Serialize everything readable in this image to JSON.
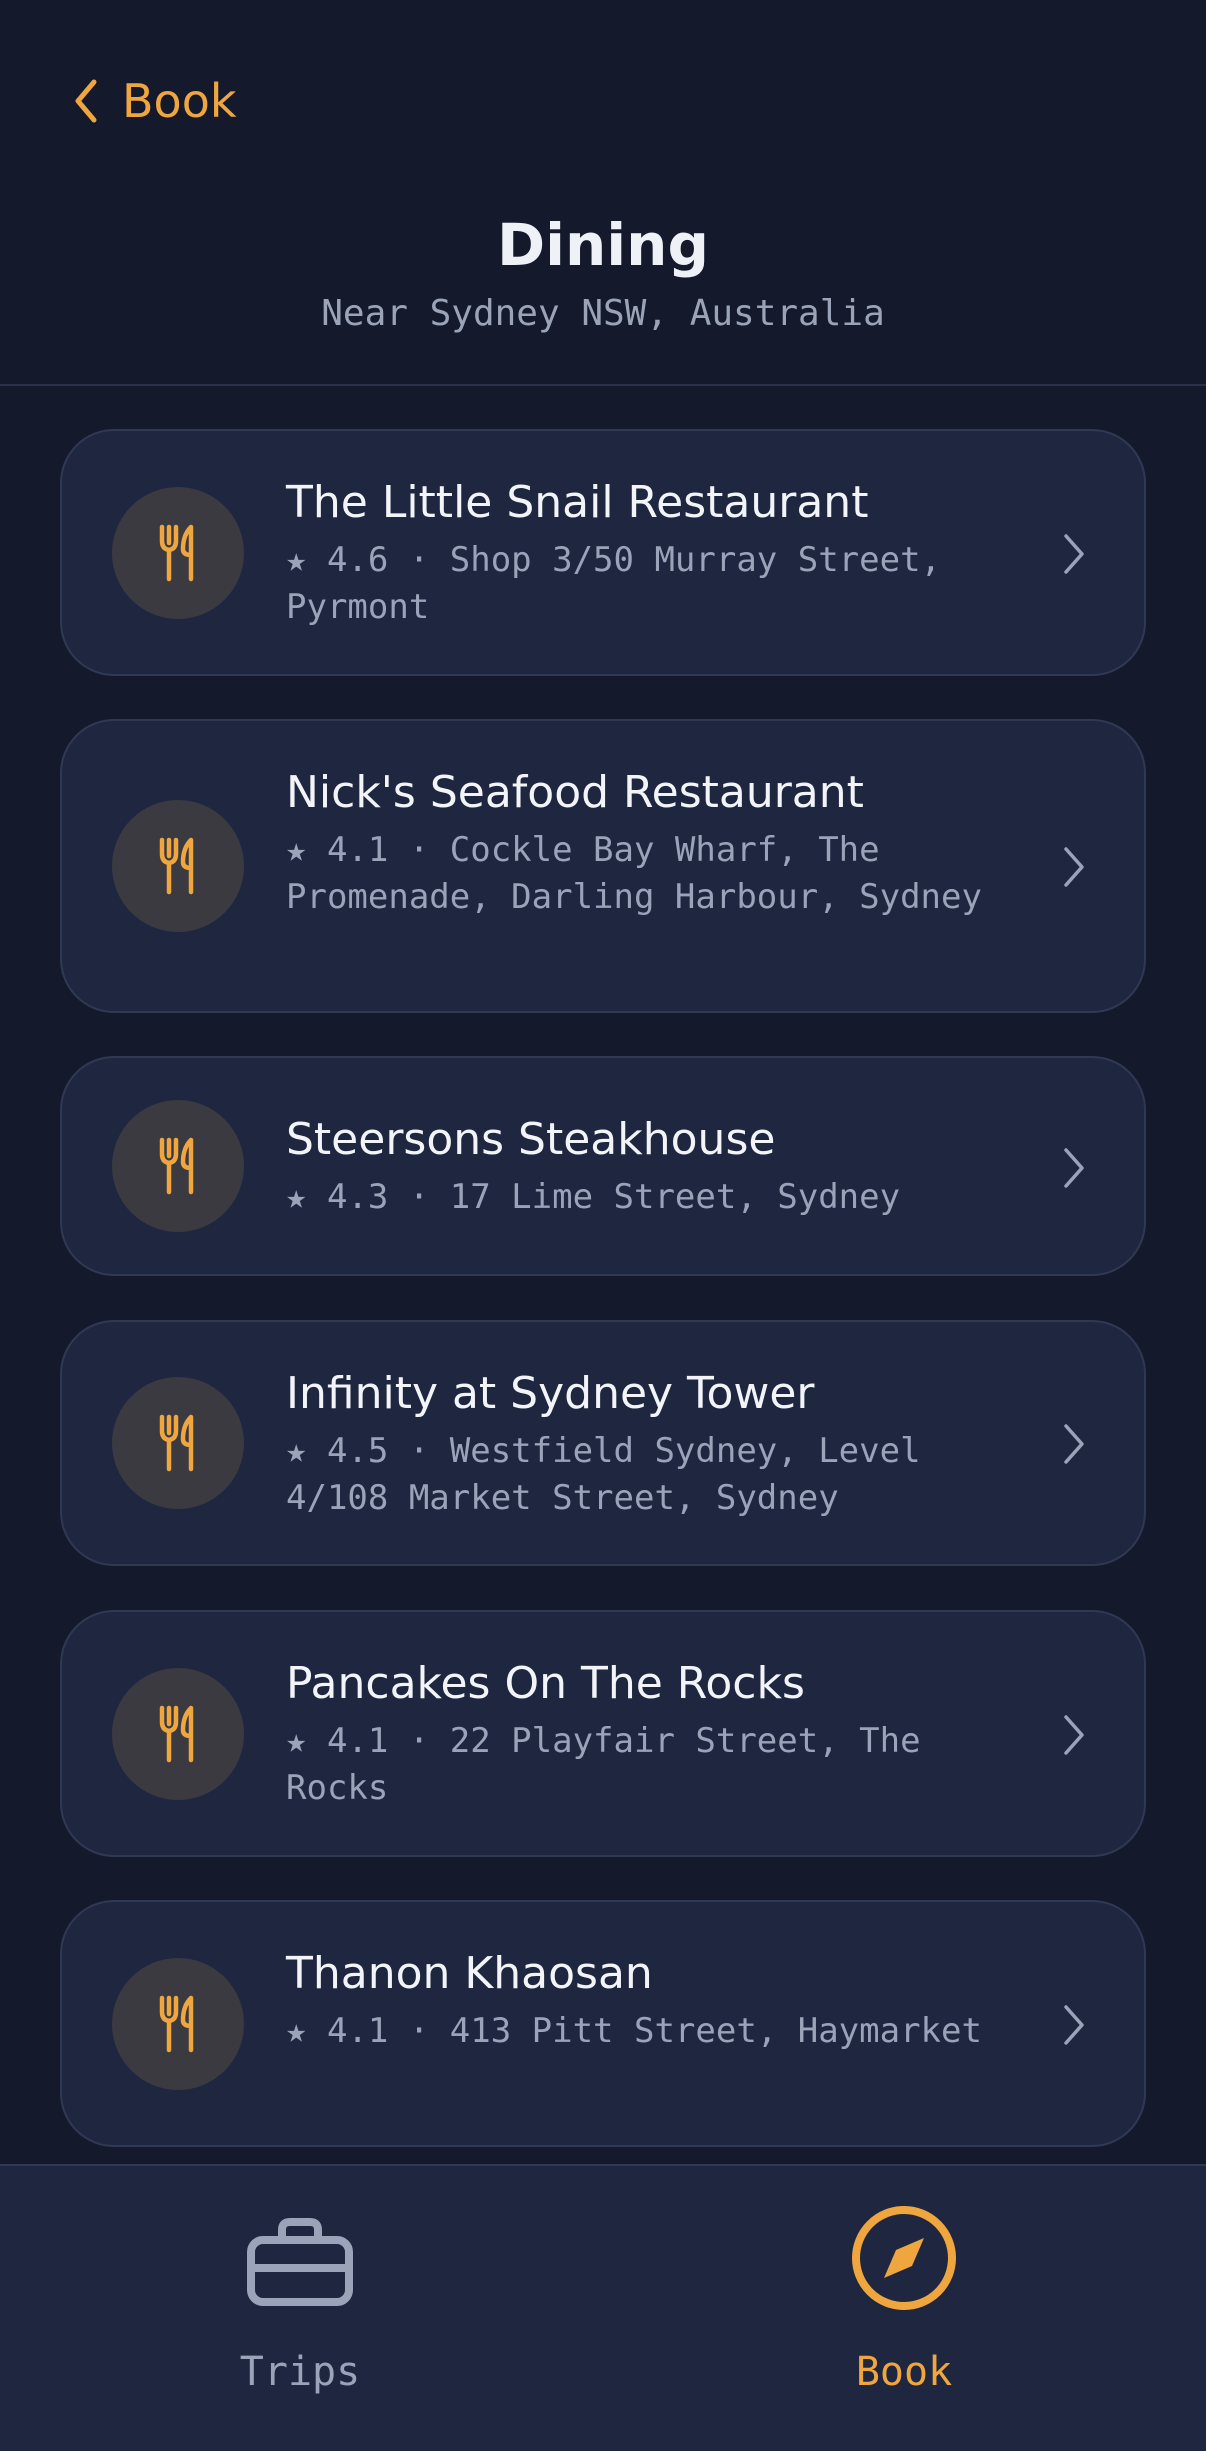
{
  "header": {
    "back_label": "Book",
    "title": "Dining",
    "subtitle": "Near Sydney NSW, Australia"
  },
  "restaurants": [
    {
      "name": "The Little Snail Restaurant",
      "meta": "★ 4.6 · Shop 3/50 Murray Street, Pyrmont"
    },
    {
      "name": "Nick's Seafood Restaurant",
      "meta": "★ 4.1 · Cockle Bay Wharf, The Promenade, Darling Harbour, Sydney"
    },
    {
      "name": "Steersons Steakhouse",
      "meta": "★ 4.3 · 17 Lime Street, Sydney"
    },
    {
      "name": "Infinity at Sydney Tower",
      "meta": "★ 4.5 · Westfield Sydney, Level 4/108 Market Street, Sydney"
    },
    {
      "name": "Pancakes On The Rocks",
      "meta": "★ 4.1 · 22 Playfair Street, The Rocks"
    },
    {
      "name": "Thanon Khaosan",
      "meta": "★ 4.1 · 413 Pitt Street, Haymarket"
    }
  ],
  "tabbar": {
    "tabs": [
      {
        "label": "Trips",
        "icon": "briefcase-icon",
        "active": false
      },
      {
        "label": "Book",
        "icon": "compass-icon",
        "active": true
      }
    ]
  },
  "colors": {
    "background": "#141a2c",
    "card": "#1f2740",
    "accent": "#f0a63f",
    "text_primary": "#f2f4f8",
    "text_secondary": "#9aa3b8",
    "inactive_tab": "#9aa3b8"
  }
}
